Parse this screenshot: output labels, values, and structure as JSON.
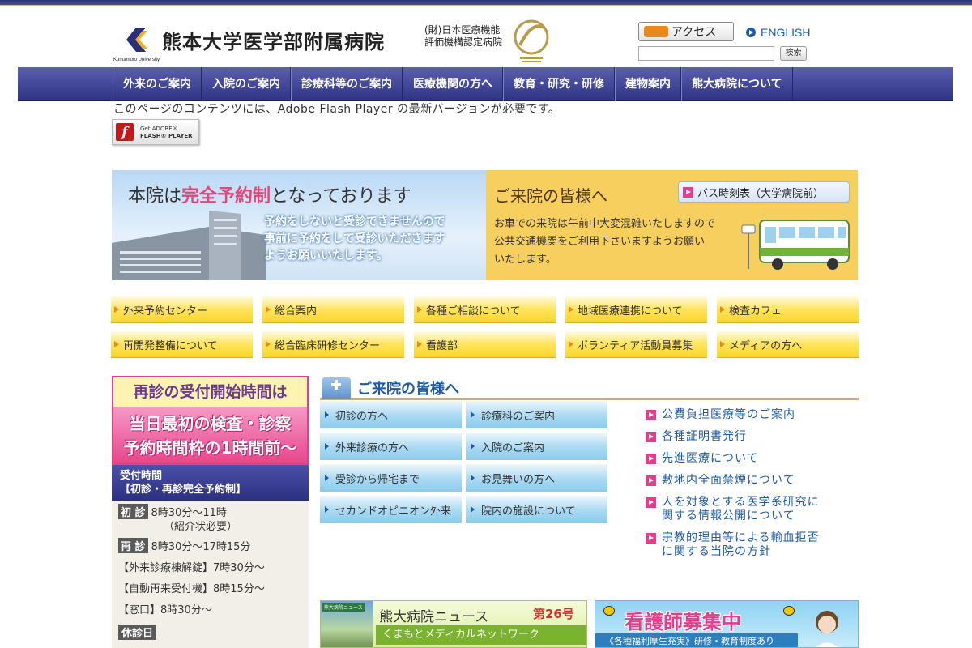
{
  "header": {
    "title": "熊本大学医学部附属病院",
    "logo_sub": "Kumamoto University",
    "cert_line1": "(財)日本医療機能",
    "cert_line2": "評価機構認定病院",
    "access_label": "アクセス",
    "english_label": "ENGLISH",
    "search_value": "",
    "search_button": "検索"
  },
  "nav": {
    "items": [
      "外来のご案内",
      "入院のご案内",
      "診療科等のご案内",
      "医療機関の方へ",
      "教育・研究・研修",
      "建物案内",
      "熊大病院について"
    ]
  },
  "flash": {
    "message": "このページのコンテンツには、Adobe Flash Player の最新バージョンが必要です。",
    "badge_line1": "Get ADOBE®",
    "badge_line2": "FLASH® PLAYER"
  },
  "banner_left": {
    "headline_pre": "本院は",
    "headline_em": "完全予約制",
    "headline_post": "となっております",
    "body1": "予約をしないと受診できませんので",
    "body2": "事前に予約をして受診いただきます",
    "body3": "ようお願いいたします。"
  },
  "banner_right": {
    "title": "ご来院の皆様へ",
    "bus_link": "バス時刻表（大学病院前）",
    "body1": "お車での来院は午前中大変混雑いたしますので",
    "body2": "公共交通機関をご利用下さいますようお願い",
    "body3": "いたします。"
  },
  "quicklinks": [
    "外来予約センター",
    "総合案内",
    "各種ご相談について",
    "地域医療連携について",
    "検査カフェ",
    "再開発整備について",
    "総合臨床研修センター",
    "看護部",
    "ボランティア活動員募集",
    "メディアの方へ"
  ],
  "sidebar": {
    "head": "再診の受付開始時間は",
    "pink1": "当日最初の検査・診察",
    "pink2": "予約時間枠の1時間前〜",
    "navy1": "受付時間",
    "navy2": "【初診・再診完全予約制】",
    "first_tag": "初 診",
    "first_time": "8時30分〜11時",
    "first_note": "（紹介状必要）",
    "revisit_tag": "再 診",
    "revisit_time": "8時30分〜17時15分",
    "row3": "【外来診療棟解錠】7時30分〜",
    "row4": "【自動再来受付機】8時15分〜",
    "row5": "【窓口】8時30分〜",
    "closed": "休診日"
  },
  "visit": {
    "title": "ご来院の皆様へ",
    "buttons": [
      "初診の方へ",
      "診療科のご案内",
      "外来診療の方へ",
      "入院のご案内",
      "受診から帰宅まで",
      "お見舞いの方へ",
      "セカンドオピニオン外来",
      "院内の施設について"
    ]
  },
  "info_links": [
    {
      "line1": "公費負担医療等のご案内",
      "line2": ""
    },
    {
      "line1": "各種証明書発行",
      "line2": ""
    },
    {
      "line1": "先進医療について",
      "line2": ""
    },
    {
      "line1": "敷地内全面禁煙について",
      "line2": ""
    },
    {
      "line1": "人を対象とする医学系研究に",
      "line2": "関する情報公開について"
    },
    {
      "line1": "宗教的理由等による輸血拒否",
      "line2": "に関する当院の方針"
    }
  ],
  "news": {
    "label": "熊大病院ニュース",
    "name": "熊大病院ニュース",
    "issue": "第26号",
    "sub": "くまもとメディカルネットワーク"
  },
  "nurse": {
    "title": "看護師募集中",
    "sub": "《各種福利厚生充実》研修・教育制度あり"
  },
  "colors": {
    "nav": "#2e3382",
    "accent_pink": "#e43d8b",
    "link_blue": "#1d5aa7",
    "quicklink_yellow": "#ffe45c",
    "banner_gold": "#f7cf5e"
  }
}
